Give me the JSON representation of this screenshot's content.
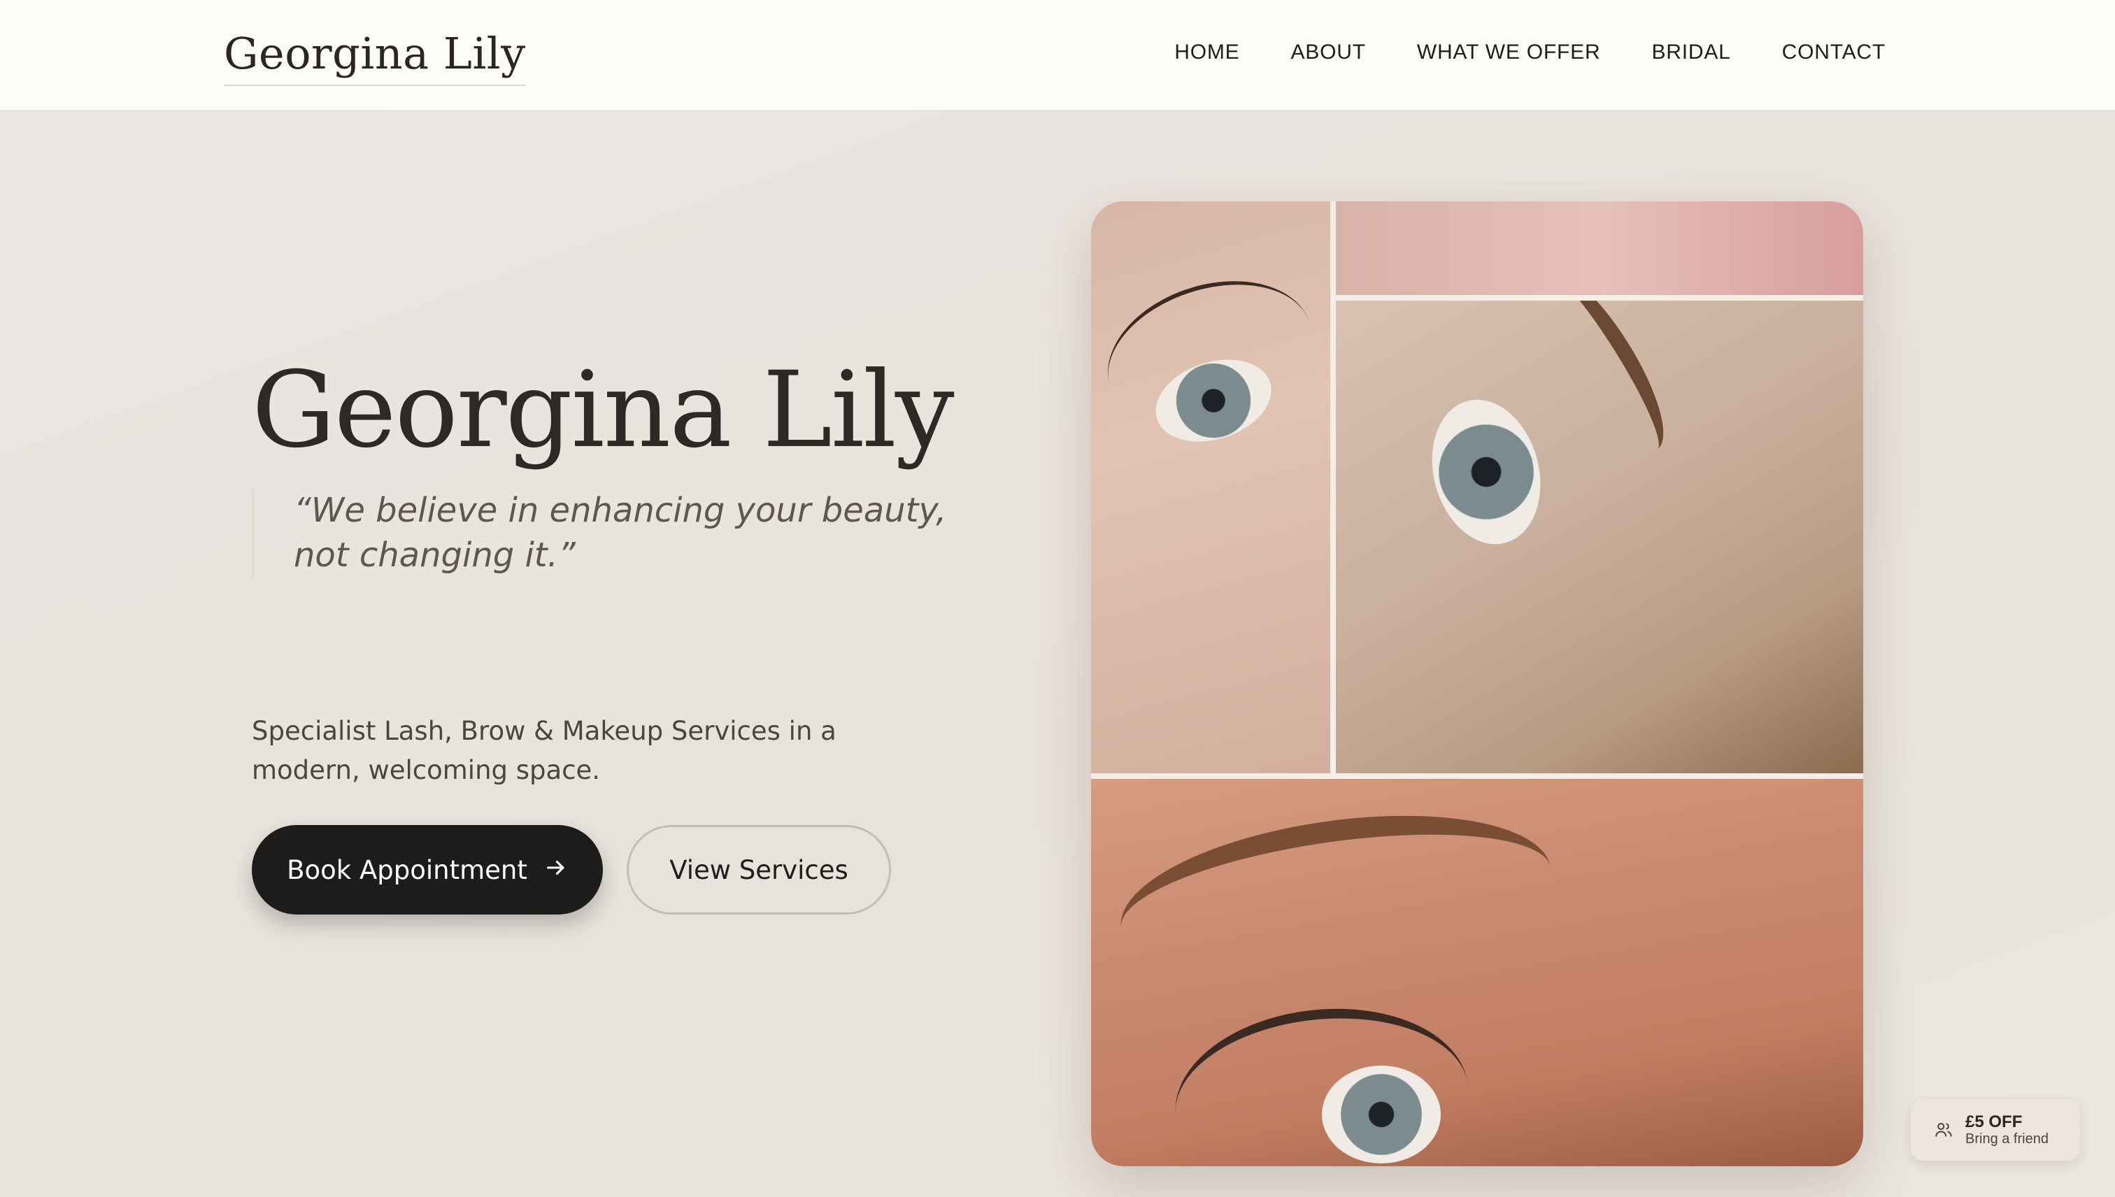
{
  "header": {
    "logo": "Georgina Lily",
    "nav": [
      {
        "label": "HOME"
      },
      {
        "label": "ABOUT"
      },
      {
        "label": "WHAT WE OFFER"
      },
      {
        "label": "BRIDAL"
      },
      {
        "label": "CONTACT"
      }
    ]
  },
  "hero": {
    "title": "Georgina Lily",
    "quote": "“We believe in enhancing your beauty, not changing it.”",
    "tagline": "Specialist Lash, Brow & Makeup Services in a modern, welcoming space.",
    "primary_button": "Book Appointment",
    "primary_button_icon": "arrow-right-icon",
    "secondary_button": "View Services"
  },
  "promo": {
    "title": "£5 OFF",
    "subtitle": "Bring a friend",
    "icon": "users-icon"
  },
  "colors": {
    "header_bg": "#fdfcf9",
    "hero_bg": "#ebe5df",
    "primary_button_bg": "#1e1c1b",
    "text_dark": "#2b2623"
  }
}
